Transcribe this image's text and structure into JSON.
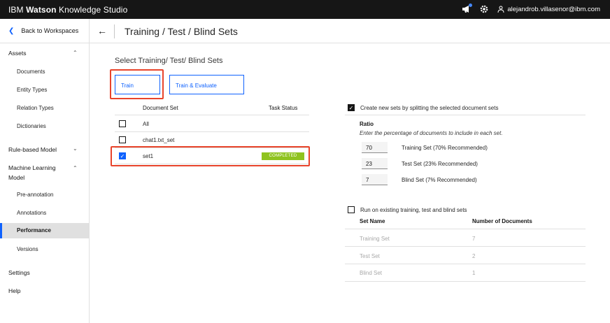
{
  "app": {
    "brand_prefix": "IBM",
    "brand_bold": "Watson",
    "brand_suffix": " Knowledge Studio",
    "user_email": "alejandrob.villasenor@ibm.com"
  },
  "sidebar": {
    "back_label": "Back to Workspaces",
    "assets": "Assets",
    "documents": "Documents",
    "entity_types": "Entity Types",
    "relation_types": "Relation Types",
    "dictionaries": "Dictionaries",
    "rule_based": "Rule-based Model",
    "ml_model_1": "Machine Learning",
    "ml_model_2": "Model",
    "pre_annotation": "Pre-annotation",
    "annotations": "Annotations",
    "performance": "Performance",
    "versions": "Versions",
    "settings": "Settings",
    "help": "Help"
  },
  "header": {
    "title": "Training / Test / Blind Sets"
  },
  "main": {
    "select_label": "Select Training/ Test/ Blind Sets",
    "train_button": "Train",
    "train_evaluate_button": "Train & Evaluate",
    "col_document_set": "Document Set",
    "col_task_status": "Task Status",
    "rows": [
      {
        "name": "All",
        "checked": false,
        "status": ""
      },
      {
        "name": "chat1.txt_set",
        "checked": false,
        "status": ""
      },
      {
        "name": "set1",
        "checked": true,
        "status": "COMPLETED"
      }
    ]
  },
  "right": {
    "create_label": "Create new sets by splitting the selected document sets",
    "ratio_title": "Ratio",
    "ratio_desc": "Enter the percentage of documents to include in each set.",
    "training_value": "70",
    "training_label": "Training Set  (70% Recommended)",
    "test_value": "23",
    "test_label": "Test Set  (23% Recommended)",
    "blind_value": "7",
    "blind_label": "Blind Set  (7% Recommended)",
    "existing_label": "Run on existing training, test and blind sets",
    "col_set_name": "Set Name",
    "col_num_docs": "Number of Documents",
    "sets": [
      {
        "name": "Training Set",
        "count": "7"
      },
      {
        "name": "Test Set",
        "count": "2"
      },
      {
        "name": "Blind Set",
        "count": "1"
      }
    ]
  },
  "colors": {
    "accent": "#0f62fe",
    "highlight": "#e8442b",
    "completed": "#8fc31f"
  }
}
